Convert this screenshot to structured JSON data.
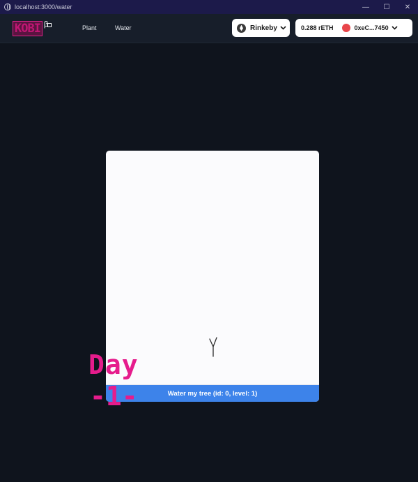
{
  "window": {
    "url": "localhost:3000/water",
    "minimize_glyph": "—",
    "maximize_glyph": "☐"
  },
  "header": {
    "logo_text": "KOBI",
    "logo_beta": "β",
    "nav": [
      {
        "label": "Plant"
      },
      {
        "label": "Water"
      }
    ],
    "network": {
      "name": "Rinkeby",
      "icon": "ethereum-icon"
    },
    "account": {
      "balance": "0.288 rETH",
      "address": "0xeC...7450",
      "avatar_color": "#e8454a"
    },
    "chevron_glyph": "⌄"
  },
  "card": {
    "button_label": "Water my tree (id: 0, level: 1)",
    "button_color": "#3d83ea"
  },
  "overlay": {
    "day_label": "Day",
    "day_number": "-1-",
    "color": "#e61c8c"
  }
}
